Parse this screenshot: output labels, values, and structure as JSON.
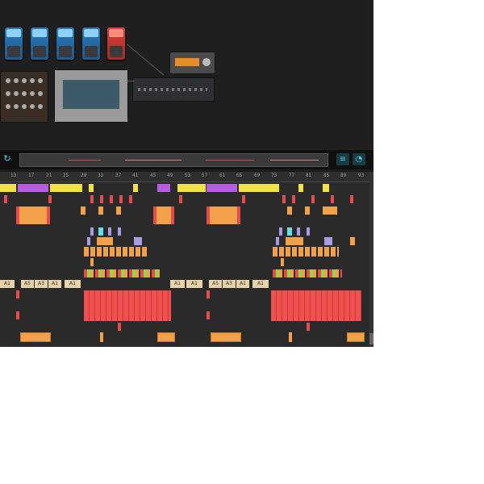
{
  "transport": {
    "loop_icon": "↻",
    "overview_label": "",
    "action1_icon": "≡",
    "action2_icon": "◔"
  },
  "ruler": {
    "marks": [
      "13",
      "17",
      "21",
      "25",
      "29",
      "33",
      "37",
      "41",
      "45",
      "49",
      "53",
      "57",
      "61",
      "65",
      "69",
      "73",
      "77",
      "81",
      "85",
      "89",
      "93"
    ]
  },
  "clips": {
    "label_a1": "A1",
    "label_a5": "A5",
    "label_a3": "A3"
  },
  "colors": {
    "yellow": "#f2e24a",
    "purple": "#b45de0",
    "red": "#e64c4c",
    "orange": "#f2a14a",
    "lavender": "#a99de8",
    "cyan": "#66e0e8",
    "green": "#92d64a",
    "tan": "#e8d2a8",
    "salmon": "#f05050"
  }
}
